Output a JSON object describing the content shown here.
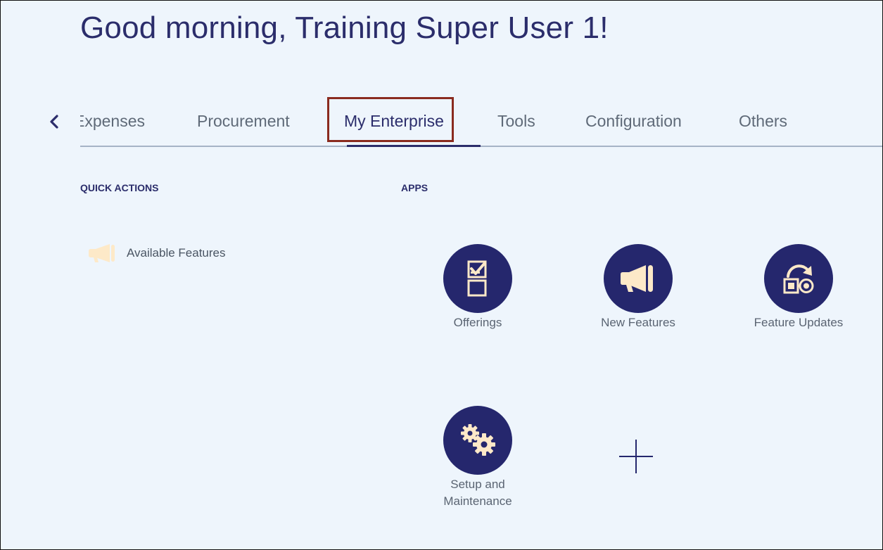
{
  "greeting": "Good morning, Training Super User 1!",
  "nav": {
    "back_icon": "chevron-left-icon",
    "tabs": [
      {
        "label": "Expenses"
      },
      {
        "label": "Procurement"
      },
      {
        "label": "My Enterprise",
        "active": true
      },
      {
        "label": "Tools"
      },
      {
        "label": "Configuration"
      },
      {
        "label": "Others"
      }
    ]
  },
  "quick_actions": {
    "title": "QUICK ACTIONS",
    "items": [
      {
        "label": "Available Features",
        "icon": "megaphone-icon"
      }
    ]
  },
  "apps": {
    "title": "APPS",
    "items": [
      {
        "label": "Offerings",
        "icon": "checklist-icon"
      },
      {
        "label": "New Features",
        "icon": "megaphone-icon"
      },
      {
        "label": "Feature Updates",
        "icon": "feature-update-icon"
      },
      {
        "label": "Setup and Maintenance",
        "icon": "gears-icon"
      }
    ],
    "add_icon": "plus-icon"
  },
  "colors": {
    "page_background": "#eef5fc",
    "primary_navy": "#25276d",
    "icon_cream": "#fde9c8",
    "highlight_border": "#8a2b1f",
    "tab_text": "#5f6a78",
    "tab_baseline": "#a5b3c6"
  }
}
